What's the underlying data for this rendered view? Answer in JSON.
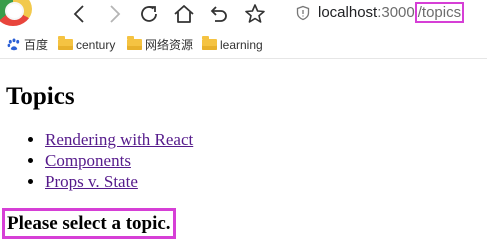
{
  "browser": {
    "address_bar": {
      "host": "localhost",
      "port": ":3000",
      "path": "/topics"
    },
    "nav_icons": [
      "back-icon",
      "forward-icon",
      "reload-icon",
      "home-icon",
      "undo-icon",
      "bookmark-star-icon"
    ]
  },
  "bookmarks": [
    {
      "label": "百度",
      "icon": "baidu-paw-icon"
    },
    {
      "label": "century",
      "icon": "folder-icon"
    },
    {
      "label": "网络资源",
      "icon": "folder-icon"
    },
    {
      "label": "learning",
      "icon": "folder-icon"
    }
  ],
  "page": {
    "title": "Topics",
    "links": [
      {
        "label": "Rendering with React"
      },
      {
        "label": "Components"
      },
      {
        "label": "Props v. State"
      }
    ],
    "selection_prompt": "Please select a topic."
  },
  "colors": {
    "highlight": "#d63fd6",
    "visited_link": "#551a8b"
  }
}
